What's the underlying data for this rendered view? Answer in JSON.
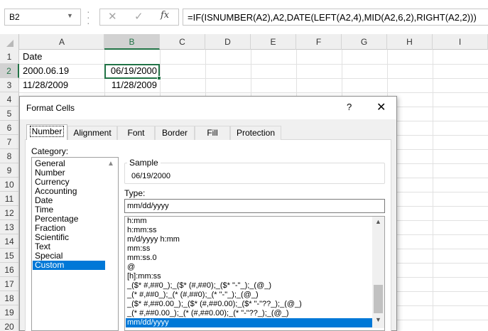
{
  "formula_bar": {
    "name_box": "B2",
    "cancel_glyph": "✕",
    "enter_glyph": "✓",
    "fx_label": "fx",
    "formula": "=IF(ISNUMBER(A2),A2,DATE(LEFT(A2,4),MID(A2,6,2),RIGHT(A2,2)))"
  },
  "sheet": {
    "columns": [
      "A",
      "B",
      "C",
      "D",
      "E",
      "F",
      "G",
      "H",
      "I"
    ],
    "rows": [
      "1",
      "2",
      "3",
      "4",
      "5",
      "6",
      "7",
      "8",
      "9",
      "10",
      "11",
      "12",
      "13",
      "14",
      "15",
      "16",
      "17",
      "18",
      "19",
      "20"
    ],
    "selected_column": "B",
    "selected_row": "2",
    "cells": {
      "A1": "Date",
      "A2": "2000.06.19",
      "A3": "11/28/2009",
      "B2": "06/19/2000",
      "B3": "11/28/2009"
    }
  },
  "dialog": {
    "title": "Format Cells",
    "help": "?",
    "close": "✕",
    "tabs": [
      "Number",
      "Alignment",
      "Font",
      "Border",
      "Fill",
      "Protection"
    ],
    "active_tab": "Number",
    "category_label": "Category:",
    "categories": [
      "General",
      "Number",
      "Currency",
      "Accounting",
      "Date",
      "Time",
      "Percentage",
      "Fraction",
      "Scientific",
      "Text",
      "Special",
      "Custom"
    ],
    "selected_category": "Custom",
    "sample_label": "Sample",
    "sample_value": "06/19/2000",
    "type_label": "Type:",
    "type_value": "mm/dd/yyyy",
    "type_list": [
      "h:mm",
      "h:mm:ss",
      "m/d/yyyy h:mm",
      "mm:ss",
      "mm:ss.0",
      "@",
      "[h]:mm:ss",
      "_($* #,##0_);_($* (#,##0);_($* \"-\"_);_(@_)",
      "_(* #,##0_);_(* (#,##0);_(* \"-\"_);_(@_)",
      "_($* #,##0.00_);_($* (#,##0.00);_($* \"-\"??_);_(@_)",
      "_(* #,##0.00_);_(* (#,##0.00);_(* \"-\"??_);_(@_)",
      "mm/dd/yyyy"
    ],
    "selected_type": "mm/dd/yyyy"
  },
  "colors": {
    "excel_green": "#217346",
    "selection_blue": "#0078d7"
  }
}
